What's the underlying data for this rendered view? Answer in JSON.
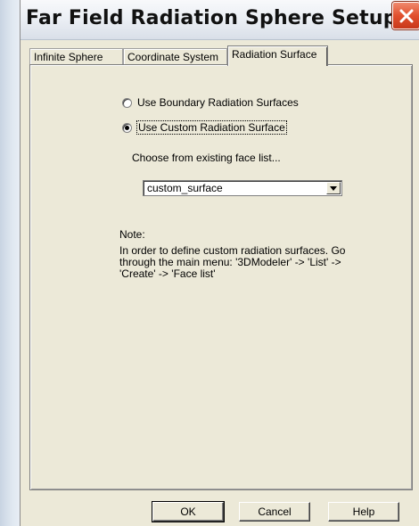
{
  "window": {
    "title": "Far Field Radiation Sphere Setup",
    "close_icon": "close-x-icon"
  },
  "tabs": [
    {
      "label": "Infinite Sphere",
      "active": false
    },
    {
      "label": "Coordinate System",
      "active": false
    },
    {
      "label": "Radiation Surface",
      "active": true
    }
  ],
  "radiation_surface": {
    "option_boundary": {
      "label": "Use Boundary Radiation Surfaces",
      "selected": false
    },
    "option_custom": {
      "label": "Use Custom Radiation Surface",
      "selected": true
    },
    "choose_label": "Choose from existing face list...",
    "face_list": {
      "selected": "custom_surface"
    },
    "note_title": "Note:",
    "note_body": "In order to define custom radiation surfaces. Go through the main menu: '3DModeler' -> 'List' -> 'Create' -> 'Face list'"
  },
  "buttons": {
    "ok": "OK",
    "cancel": "Cancel",
    "help": "Help"
  }
}
